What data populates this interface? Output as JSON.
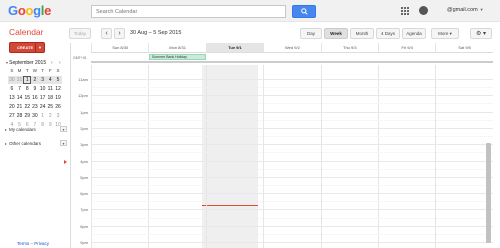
{
  "header": {
    "logo_letters": [
      {
        "char": "G",
        "color": "#4285f4"
      },
      {
        "char": "o",
        "color": "#ea4335"
      },
      {
        "char": "o",
        "color": "#fbbc05"
      },
      {
        "char": "g",
        "color": "#4285f4"
      },
      {
        "char": "l",
        "color": "#34a853"
      },
      {
        "char": "e",
        "color": "#ea4335"
      }
    ],
    "search_placeholder": "Search Calendar",
    "account": "@gmail.com"
  },
  "toolbar": {
    "app_title": "Calendar",
    "today_label": "Today",
    "prev_label": "‹",
    "next_label": "›",
    "date_range": "30 Aug – 5 Sep 2015",
    "views": [
      "Day",
      "Week",
      "Month",
      "4 Days",
      "Agenda"
    ],
    "active_view": "Week",
    "more_label": "More ▾",
    "settings_label": "⚙ ▾"
  },
  "sidebar": {
    "create_label": "CREATE",
    "mini_month": "September 2015",
    "dow": [
      "S",
      "M",
      "T",
      "W",
      "T",
      "F",
      "S"
    ],
    "weeks": [
      [
        "30",
        "31",
        "1",
        "2",
        "3",
        "4",
        "5"
      ],
      [
        "6",
        "7",
        "8",
        "9",
        "10",
        "11",
        "12"
      ],
      [
        "13",
        "14",
        "15",
        "16",
        "17",
        "18",
        "19"
      ],
      [
        "20",
        "21",
        "22",
        "23",
        "24",
        "25",
        "26"
      ],
      [
        "27",
        "28",
        "29",
        "30",
        "1",
        "2",
        "3"
      ],
      [
        "4",
        "5",
        "6",
        "7",
        "8",
        "9",
        "10"
      ]
    ],
    "my_calendars": "My calendars",
    "other_calendars": "Other calendars",
    "terms": "Terms",
    "privacy": "Privacy"
  },
  "calendar": {
    "timezone": "GMT+01",
    "days": [
      "Sun 8/30",
      "Mon 8/31",
      "Tue 9/1",
      "Wed 9/2",
      "Thu 9/3",
      "Fri 9/4",
      "Sat 9/5"
    ],
    "today_index": 2,
    "event": {
      "title": "Summer Bank Holiday",
      "day_index": 1
    },
    "hours": [
      "11am",
      "12pm",
      "1pm",
      "2pm",
      "3pm",
      "4pm",
      "5pm",
      "6pm",
      "7pm",
      "8pm",
      "9pm"
    ],
    "colors": {
      "accent": "#dd4b39",
      "event_bg": "#c7ecd8",
      "search_button": "#4787ed"
    }
  }
}
